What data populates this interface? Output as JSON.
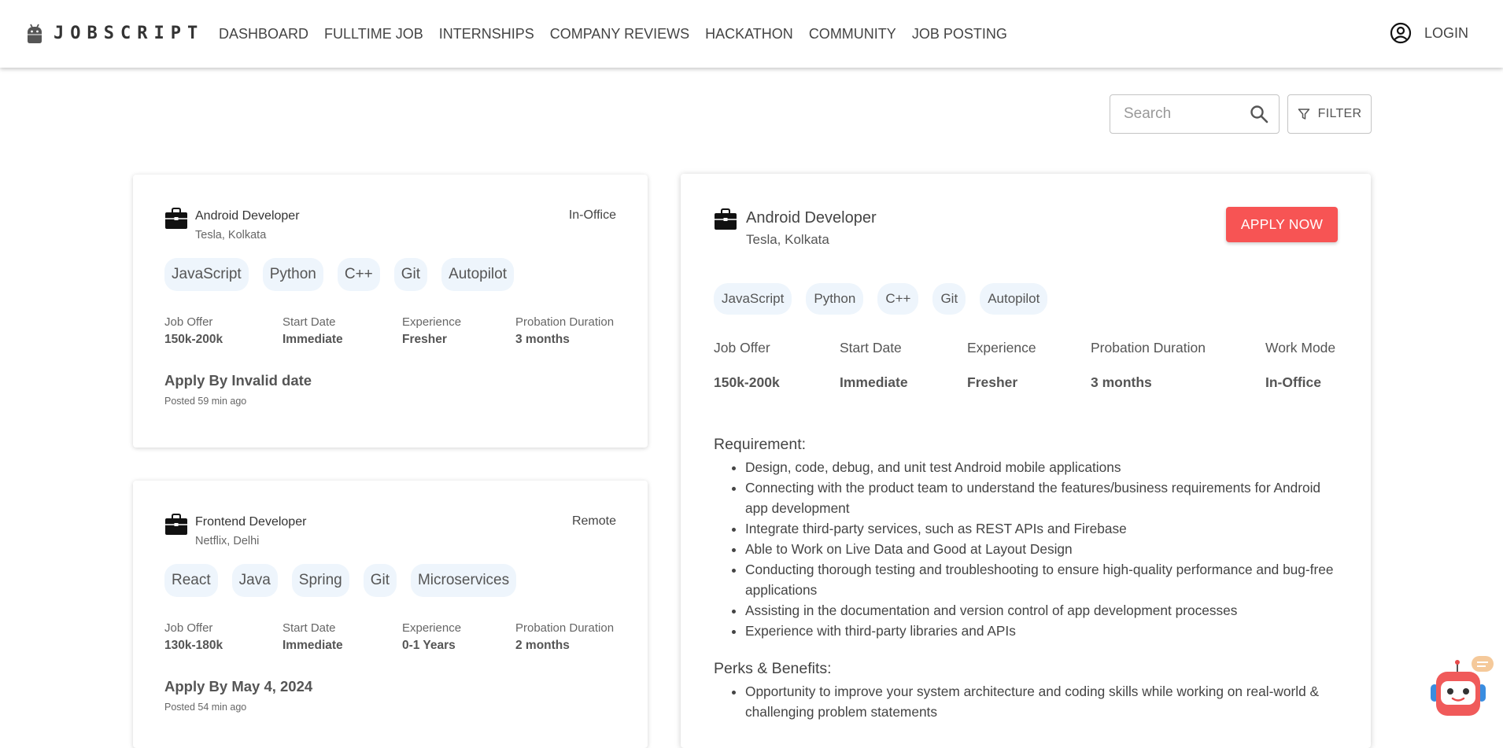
{
  "brand": {
    "name": "JOBSCRIPT",
    "logo_icon": "android-robot-icon"
  },
  "nav": {
    "links": [
      "DASHBOARD",
      "FULLTIME JOB",
      "INTERNSHIPS",
      "COMPANY REVIEWS",
      "HACKATHON",
      "COMMUNITY",
      "JOB POSTING"
    ],
    "login_label": "LOGIN",
    "login_icon": "account-circle-icon"
  },
  "search": {
    "placeholder": "Search",
    "value": ""
  },
  "filter": {
    "label": "FILTER"
  },
  "jobs": [
    {
      "title": "Android Developer",
      "company": "Tesla, Kolkata",
      "mode": "In-Office",
      "skills": [
        "JavaScript",
        "Python",
        "C++",
        "Git",
        "Autopilot"
      ],
      "metrics": [
        {
          "label": "Job Offer",
          "value": "150k-200k"
        },
        {
          "label": "Start Date",
          "value": "Immediate"
        },
        {
          "label": "Experience",
          "value": "Fresher"
        },
        {
          "label": "Probation Duration",
          "value": "3 months"
        }
      ],
      "apply_by": "Apply By Invalid date",
      "posted": "Posted 59 min ago"
    },
    {
      "title": "Frontend Developer",
      "company": "Netflix, Delhi",
      "mode": "Remote",
      "skills": [
        "React",
        "Java",
        "Spring",
        "Git",
        "Microservices"
      ],
      "metrics": [
        {
          "label": "Job Offer",
          "value": "130k-180k"
        },
        {
          "label": "Start Date",
          "value": "Immediate"
        },
        {
          "label": "Experience",
          "value": "0-1 Years"
        },
        {
          "label": "Probation Duration",
          "value": "2 months"
        }
      ],
      "apply_by": "Apply By May 4, 2024",
      "posted": "Posted 54 min ago"
    }
  ],
  "detail": {
    "title": "Android Developer",
    "company": "Tesla, Kolkata",
    "apply_label": "APPLY NOW",
    "skills": [
      "JavaScript",
      "Python",
      "C++",
      "Git",
      "Autopilot"
    ],
    "metrics": [
      {
        "label": "Job Offer",
        "value": "150k-200k"
      },
      {
        "label": "Start Date",
        "value": "Immediate"
      },
      {
        "label": "Experience",
        "value": "Fresher"
      },
      {
        "label": "Probation Duration",
        "value": "3 months"
      },
      {
        "label": "Work Mode",
        "value": "In-Office"
      }
    ],
    "requirement_title": "Requirement:",
    "requirements": [
      "Design, code, debug, and unit test Android mobile applications",
      "Connecting with the product team to understand the features/business requirements for Android app development",
      "Integrate third-party services, such as REST APIs and Firebase",
      "Able to Work on Live Data and Good at Layout Design",
      "Conducting thorough testing and troubleshooting to ensure high-quality performance and bug-free applications",
      "Assisting in the documentation and version control of app development processes",
      "Experience with third-party libraries and APIs"
    ],
    "perks_title": "Perks & Benefits:",
    "perks": [
      "Opportunity to improve your system architecture and coding skills while working on real-world & challenging problem statements"
    ]
  },
  "colors": {
    "accent": "#f75454",
    "tag_bg": "#eef5fc"
  }
}
